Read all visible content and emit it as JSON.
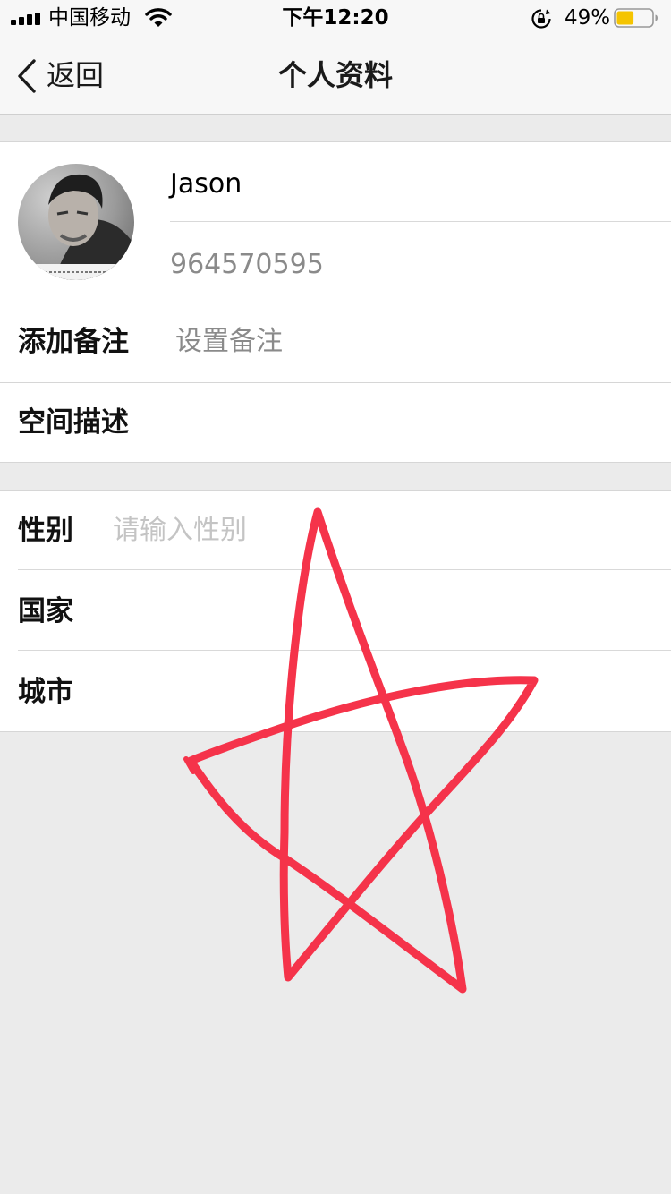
{
  "status_bar": {
    "carrier": "中国移动",
    "time": "下午12:20",
    "battery_percent": "49%",
    "battery_level": 0.49,
    "icons": [
      "signal-icon",
      "wifi-icon",
      "rotation-lock-icon",
      "battery-icon"
    ]
  },
  "nav": {
    "back_label": "返回",
    "title": "个人资料"
  },
  "profile": {
    "name": "Jason",
    "id": "964570595"
  },
  "remark": {
    "label": "添加备注",
    "placeholder": "设置备注"
  },
  "space": {
    "label": "空间描述"
  },
  "info": {
    "gender_label": "性别",
    "gender_placeholder": "请输入性别",
    "country_label": "国家",
    "city_label": "城市"
  },
  "colors": {
    "annotation_red": "#f5334a",
    "background": "#ebebeb",
    "battery_fill": "#f5c400"
  }
}
